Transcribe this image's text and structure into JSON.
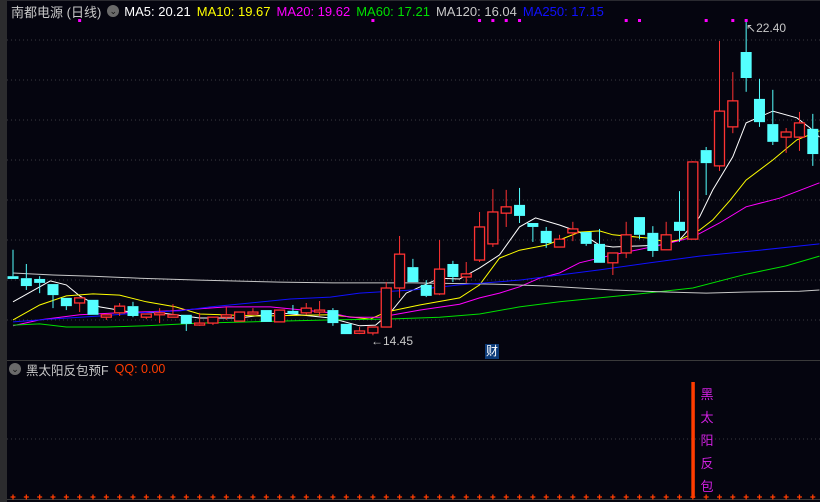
{
  "header": {
    "stock_title": "南都电源 (日线)",
    "ma": [
      {
        "label": "MA5: 20.21",
        "color": "#ffffff"
      },
      {
        "label": "MA10: 19.67",
        "color": "#ffff00"
      },
      {
        "label": "MA20: 19.62",
        "color": "#ff00ff"
      },
      {
        "label": "MA60: 17.21",
        "color": "#00e000"
      },
      {
        "label": "MA120: 16.04",
        "color": "#c8c8c8"
      },
      {
        "label": "MA250: 17.15",
        "color": "#1010ff"
      }
    ]
  },
  "indicator": {
    "name": "黑太阳反包预F",
    "value_label": "QQ: 0.00",
    "signal_chars": [
      "黑",
      "太",
      "阳",
      "反",
      "包"
    ],
    "signal_index": 51,
    "color": "#ff3c00"
  },
  "badge": {
    "finance": "财"
  },
  "colors": {
    "up": "#ff3232",
    "down": "#54ffff",
    "bg": "#05050f",
    "grid": "#3a3a40",
    "marker": "#ff00ff"
  },
  "chart_data": {
    "type": "candlestick",
    "price_range": [
      14.45,
      22.4
    ],
    "high_label": "22.40",
    "low_label": "14.45",
    "high_index": 55,
    "low_index": 27,
    "candles": [
      [
        15.95,
        16.62,
        15.88,
        15.88
      ],
      [
        15.9,
        16.26,
        15.6,
        15.7
      ],
      [
        15.88,
        15.95,
        15.52,
        15.78
      ],
      [
        15.75,
        15.75,
        15.14,
        15.47
      ],
      [
        15.4,
        15.4,
        15.09,
        15.19
      ],
      [
        15.27,
        15.4,
        15.04,
        15.4
      ],
      [
        15.35,
        15.35,
        14.97,
        14.97
      ],
      [
        14.91,
        14.97,
        14.84,
        14.97
      ],
      [
        15.02,
        15.27,
        14.94,
        15.19
      ],
      [
        15.19,
        15.3,
        14.91,
        14.94
      ],
      [
        14.91,
        14.99,
        14.86,
        14.99
      ],
      [
        14.97,
        15.14,
        14.76,
        15.02
      ],
      [
        14.91,
        15.24,
        14.91,
        14.97
      ],
      [
        14.97,
        14.97,
        14.56,
        14.74
      ],
      [
        14.71,
        15.02,
        14.69,
        14.76
      ],
      [
        14.76,
        14.91,
        14.71,
        14.91
      ],
      [
        14.91,
        15.17,
        14.84,
        14.97
      ],
      [
        14.81,
        15.04,
        14.81,
        15.04
      ],
      [
        14.99,
        15.14,
        14.99,
        15.04
      ],
      [
        15.09,
        15.09,
        14.79,
        14.79
      ],
      [
        14.79,
        15.09,
        14.79,
        15.09
      ],
      [
        15.07,
        15.22,
        14.99,
        14.99
      ],
      [
        15.02,
        15.27,
        14.97,
        15.14
      ],
      [
        15.04,
        15.32,
        14.94,
        15.09
      ],
      [
        15.09,
        15.14,
        14.69,
        14.76
      ],
      [
        14.74,
        14.74,
        14.48,
        14.48
      ],
      [
        14.5,
        14.66,
        14.48,
        14.56
      ],
      [
        14.51,
        14.66,
        14.45,
        14.66
      ],
      [
        14.66,
        15.8,
        14.66,
        15.65
      ],
      [
        15.65,
        16.97,
        15.4,
        16.51
      ],
      [
        16.18,
        16.39,
        15.8,
        15.8
      ],
      [
        15.73,
        15.85,
        15.42,
        15.45
      ],
      [
        15.5,
        16.87,
        15.47,
        16.13
      ],
      [
        16.26,
        16.34,
        15.8,
        15.93
      ],
      [
        15.93,
        16.31,
        15.78,
        16.01
      ],
      [
        16.36,
        17.58,
        16.31,
        17.2
      ],
      [
        16.77,
        18.16,
        16.69,
        17.58
      ],
      [
        17.55,
        18.14,
        17.2,
        17.71
      ],
      [
        17.76,
        18.19,
        17.3,
        17.48
      ],
      [
        17.3,
        17.3,
        16.82,
        17.2
      ],
      [
        17.1,
        17.2,
        16.67,
        16.79
      ],
      [
        16.69,
        17.0,
        16.69,
        16.89
      ],
      [
        17.05,
        17.33,
        16.84,
        17.15
      ],
      [
        17.07,
        17.07,
        16.72,
        16.77
      ],
      [
        16.77,
        17.15,
        16.29,
        16.29
      ],
      [
        16.29,
        16.54,
        15.98,
        16.54
      ],
      [
        16.54,
        17.33,
        16.41,
        17.0
      ],
      [
        17.45,
        17.45,
        16.89,
        17.0
      ],
      [
        17.05,
        17.22,
        16.44,
        16.59
      ],
      [
        16.62,
        17.33,
        16.62,
        17.0
      ],
      [
        17.33,
        18.11,
        16.82,
        17.1
      ],
      [
        16.89,
        18.87,
        16.89,
        18.85
      ],
      [
        19.15,
        19.23,
        18.01,
        18.82
      ],
      [
        18.75,
        21.92,
        18.62,
        20.14
      ],
      [
        19.74,
        21.13,
        19.58,
        20.4
      ],
      [
        21.64,
        22.4,
        20.63,
        20.98
      ],
      [
        20.45,
        20.96,
        19.74,
        19.86
      ],
      [
        19.81,
        20.68,
        19.28,
        19.36
      ],
      [
        19.48,
        19.71,
        19.08,
        19.61
      ],
      [
        19.48,
        20.12,
        19.13,
        19.84
      ],
      [
        19.69,
        20.07,
        18.75,
        19.05
      ]
    ],
    "candle_fields": [
      "open",
      "high",
      "low",
      "close"
    ],
    "ma_lines": [
      {
        "name": "MA5",
        "color": "#ffffff",
        "points": [
          [
            0,
            15.3
          ],
          [
            2.8,
            15.83
          ],
          [
            4,
            15.73
          ],
          [
            5,
            15.45
          ],
          [
            6.5,
            15.17
          ],
          [
            8.8,
            15.04
          ],
          [
            11,
            15.02
          ],
          [
            14,
            14.89
          ],
          [
            17,
            14.89
          ],
          [
            20,
            15.02
          ],
          [
            23.8,
            14.89
          ],
          [
            26,
            14.69
          ],
          [
            27.2,
            14.71
          ],
          [
            28.3,
            15.02
          ],
          [
            29.5,
            15.52
          ],
          [
            32,
            15.9
          ],
          [
            33.5,
            15.88
          ],
          [
            35,
            16.16
          ],
          [
            36.5,
            16.49
          ],
          [
            38,
            17.2
          ],
          [
            39.2,
            17.43
          ],
          [
            41,
            17.25
          ],
          [
            42.5,
            17.07
          ],
          [
            44,
            16.74
          ],
          [
            45,
            16.69
          ],
          [
            48.5,
            16.74
          ],
          [
            50,
            16.87
          ],
          [
            51.5,
            17.45
          ],
          [
            52.5,
            18.14
          ],
          [
            54,
            18.98
          ],
          [
            55,
            19.84
          ],
          [
            57,
            20.14
          ],
          [
            58.8,
            19.97
          ],
          [
            59.8,
            19.71
          ],
          [
            60.5,
            19.48
          ]
        ]
      },
      {
        "name": "MA10",
        "color": "#ffff00",
        "points": [
          [
            0,
            14.84
          ],
          [
            2,
            15.22
          ],
          [
            4,
            15.45
          ],
          [
            6,
            15.5
          ],
          [
            8,
            15.47
          ],
          [
            10,
            15.3
          ],
          [
            12.2,
            15.17
          ],
          [
            14,
            14.99
          ],
          [
            18.5,
            14.94
          ],
          [
            23.8,
            14.97
          ],
          [
            26.8,
            14.86
          ],
          [
            28,
            15.04
          ],
          [
            30.5,
            15.22
          ],
          [
            33.5,
            15.4
          ],
          [
            35,
            15.73
          ],
          [
            36.5,
            16.41
          ],
          [
            38,
            16.61
          ],
          [
            40,
            16.74
          ],
          [
            41,
            16.87
          ],
          [
            42.5,
            17.07
          ],
          [
            44,
            17.1
          ],
          [
            45,
            17.0
          ],
          [
            47.6,
            16.92
          ],
          [
            49,
            16.82
          ],
          [
            50,
            16.87
          ],
          [
            51.5,
            17.12
          ],
          [
            52.5,
            17.38
          ],
          [
            53.8,
            17.88
          ],
          [
            55,
            18.39
          ],
          [
            57,
            18.9
          ],
          [
            58.8,
            19.41
          ],
          [
            60.5,
            19.64
          ]
        ]
      },
      {
        "name": "MA20",
        "color": "#ff00ff",
        "points": [
          [
            0,
            14.69
          ],
          [
            2,
            14.84
          ],
          [
            5,
            14.97
          ],
          [
            8,
            15.02
          ],
          [
            11.8,
            15.07
          ],
          [
            16,
            15.17
          ],
          [
            19.3,
            15.17
          ],
          [
            23.8,
            15.02
          ],
          [
            25.3,
            14.91
          ],
          [
            27.5,
            14.91
          ],
          [
            30.5,
            15.09
          ],
          [
            33.5,
            15.24
          ],
          [
            35,
            15.4
          ],
          [
            36.5,
            15.52
          ],
          [
            38,
            15.68
          ],
          [
            39.5,
            15.9
          ],
          [
            41,
            16.03
          ],
          [
            42.5,
            16.29
          ],
          [
            45,
            16.49
          ],
          [
            49,
            16.77
          ],
          [
            51,
            16.94
          ],
          [
            53,
            17.3
          ],
          [
            55,
            17.71
          ],
          [
            57.5,
            17.93
          ],
          [
            60.5,
            18.32
          ]
        ]
      },
      {
        "name": "MA60",
        "color": "#00e000",
        "points": [
          [
            0,
            14.71
          ],
          [
            2,
            14.74
          ],
          [
            4,
            14.66
          ],
          [
            7,
            14.66
          ],
          [
            10,
            14.69
          ],
          [
            14,
            14.76
          ],
          [
            20,
            14.81
          ],
          [
            24,
            14.84
          ],
          [
            28,
            14.86
          ],
          [
            32,
            14.91
          ],
          [
            35,
            14.99
          ],
          [
            38,
            15.17
          ],
          [
            41,
            15.3
          ],
          [
            47,
            15.5
          ],
          [
            51,
            15.65
          ],
          [
            55,
            16.0
          ],
          [
            58,
            16.21
          ],
          [
            60.5,
            16.46
          ]
        ]
      },
      {
        "name": "MA120",
        "color": "#c8c8c8",
        "points": [
          [
            0,
            16.03
          ],
          [
            3,
            15.98
          ],
          [
            6,
            15.95
          ],
          [
            9.5,
            15.9
          ],
          [
            14,
            15.85
          ],
          [
            20,
            15.8
          ],
          [
            24,
            15.78
          ],
          [
            30,
            15.78
          ],
          [
            36,
            15.75
          ],
          [
            40,
            15.7
          ],
          [
            45,
            15.6
          ],
          [
            49,
            15.55
          ],
          [
            52,
            15.52
          ],
          [
            55,
            15.55
          ],
          [
            59,
            15.57
          ],
          [
            60.5,
            15.6
          ]
        ]
      },
      {
        "name": "MA250",
        "color": "#1010ff",
        "points": [
          [
            0,
            14.79
          ],
          [
            2.8,
            14.86
          ],
          [
            6.5,
            14.94
          ],
          [
            9.5,
            15.02
          ],
          [
            12.5,
            15.07
          ],
          [
            14.8,
            15.17
          ],
          [
            17.8,
            15.27
          ],
          [
            20.8,
            15.37
          ],
          [
            23.8,
            15.42
          ],
          [
            26,
            15.52
          ],
          [
            30,
            15.6
          ],
          [
            33.5,
            15.73
          ],
          [
            38,
            15.85
          ],
          [
            41,
            15.98
          ],
          [
            44,
            16.11
          ],
          [
            47.8,
            16.29
          ],
          [
            51.5,
            16.46
          ],
          [
            56,
            16.61
          ],
          [
            60.5,
            16.77
          ]
        ]
      }
    ],
    "signal_marker_indices": [
      5,
      27,
      35,
      36,
      37,
      38,
      46,
      47,
      52,
      54,
      55
    ]
  }
}
